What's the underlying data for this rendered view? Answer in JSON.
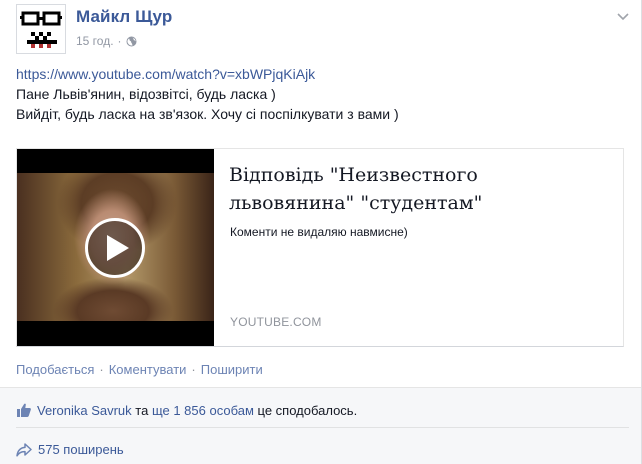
{
  "post": {
    "author": "Майкл Щур",
    "time": "15 год.",
    "separator": "·",
    "privacy_icon": "globe-icon",
    "menu_icon": "chevron-down-icon",
    "link_url": "https://www.youtube.com/watch?v=xbWPjqKiAjk",
    "lines": [
      "Пане Львів'янин, відозвітсі, будь ласка )",
      "Вийдіт, будь ласка на зв'язок. Хочу сі поспілкувати з вами )"
    ]
  },
  "attachment": {
    "title": "Відповідь \"Неизвестного львовянина\" \"студентам\"",
    "description": "Коменти не видаляю навмисне)",
    "source": "YOUTUBE.COM",
    "play_icon": "play-icon"
  },
  "actions": {
    "like": "Подобається",
    "comment": "Коментувати",
    "share": "Поширити",
    "separator": "·"
  },
  "ufi": {
    "like_user": "Veronika Savruk",
    "like_middle": " та ",
    "like_others": "ще 1 856 особам",
    "like_suffix": " це сподобалось.",
    "shares": "575 поширень"
  },
  "colors": {
    "link_blue": "#3b5998",
    "action_blue": "#6d84b4",
    "meta_gray": "#9197a3",
    "ufi_bg": "#f6f7f9"
  }
}
